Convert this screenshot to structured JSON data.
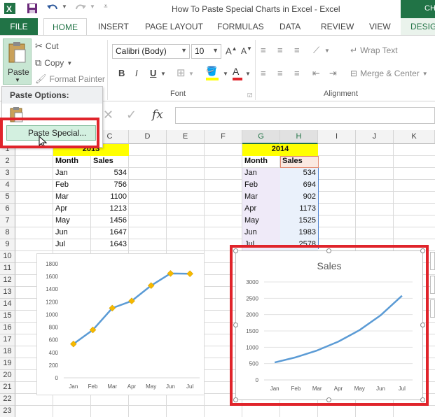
{
  "titlebar": {
    "title": "How To Paste Special Charts in Excel - Excel",
    "chart_tools": "CH"
  },
  "tabs": {
    "file": "FILE",
    "home": "HOME",
    "insert": "INSERT",
    "page_layout": "PAGE LAYOUT",
    "formulas": "FORMULAS",
    "data": "DATA",
    "review": "REVIEW",
    "view": "VIEW",
    "design": "DESIGN"
  },
  "ribbon": {
    "paste": "Paste",
    "cut": "Cut",
    "copy": "Copy",
    "format_painter": "Format Painter",
    "font_name": "Calibri (Body)",
    "font_size": "10",
    "font_group": "Font",
    "wrap_text": "Wrap Text",
    "merge_center": "Merge & Center",
    "alignment_group": "Alignment",
    "bold": "B",
    "italic": "I",
    "underline": "U",
    "font_color_letter": "A"
  },
  "paste_menu": {
    "header": "Paste Options:",
    "paste_special": "Paste Special..."
  },
  "formula_bar": {
    "fx": "fx"
  },
  "columns": [
    "C",
    "D",
    "E",
    "F",
    "G",
    "H",
    "I",
    "J",
    "K"
  ],
  "rows": [
    "1",
    "2",
    "3",
    "4",
    "5",
    "6",
    "7",
    "8",
    "9",
    "10",
    "11",
    "12",
    "13",
    "14",
    "15",
    "16",
    "17",
    "18",
    "19",
    "20",
    "21",
    "22",
    "23"
  ],
  "table2013": {
    "year": "2013",
    "header": [
      "Month",
      "Sales"
    ],
    "rows": [
      [
        "Jan",
        "534"
      ],
      [
        "Feb",
        "756"
      ],
      [
        "Mar",
        "1100"
      ],
      [
        "Apr",
        "1213"
      ],
      [
        "May",
        "1456"
      ],
      [
        "Jun",
        "1647"
      ],
      [
        "Jul",
        "1643"
      ]
    ]
  },
  "table2014": {
    "year": "2014",
    "header": [
      "Month",
      "Sales"
    ],
    "rows": [
      [
        "Jan",
        "534"
      ],
      [
        "Feb",
        "694"
      ],
      [
        "Mar",
        "902"
      ],
      [
        "Apr",
        "1173"
      ],
      [
        "May",
        "1525"
      ],
      [
        "Jun",
        "1983"
      ],
      [
        "Jul",
        "2578"
      ]
    ]
  },
  "colors": {
    "excel_green": "#217346",
    "highlight_red": "#e0242b",
    "line_blue": "#5b9bd5",
    "marker_gold": "#f5b800",
    "header_yellow": "#ffff00"
  },
  "chart_data": [
    {
      "type": "line",
      "title": "",
      "categories": [
        "Jan",
        "Feb",
        "Mar",
        "Apr",
        "May",
        "Jun",
        "Jul"
      ],
      "values": [
        534,
        756,
        1100,
        1213,
        1456,
        1647,
        1643
      ],
      "ylim": [
        0,
        1800
      ],
      "yticks": [
        "0",
        "200",
        "400",
        "600",
        "800",
        "1000",
        "1200",
        "1400",
        "1600",
        "1800"
      ],
      "markers": "diamond"
    },
    {
      "type": "line",
      "title": "Sales",
      "categories": [
        "Jan",
        "Feb",
        "Mar",
        "Apr",
        "May",
        "Jun",
        "Jul"
      ],
      "values": [
        534,
        694,
        902,
        1173,
        1525,
        1983,
        2578
      ],
      "ylim": [
        0,
        3000
      ],
      "yticks": [
        "0",
        "500",
        "1000",
        "1500",
        "2000",
        "2500",
        "3000"
      ],
      "markers": "none"
    }
  ]
}
